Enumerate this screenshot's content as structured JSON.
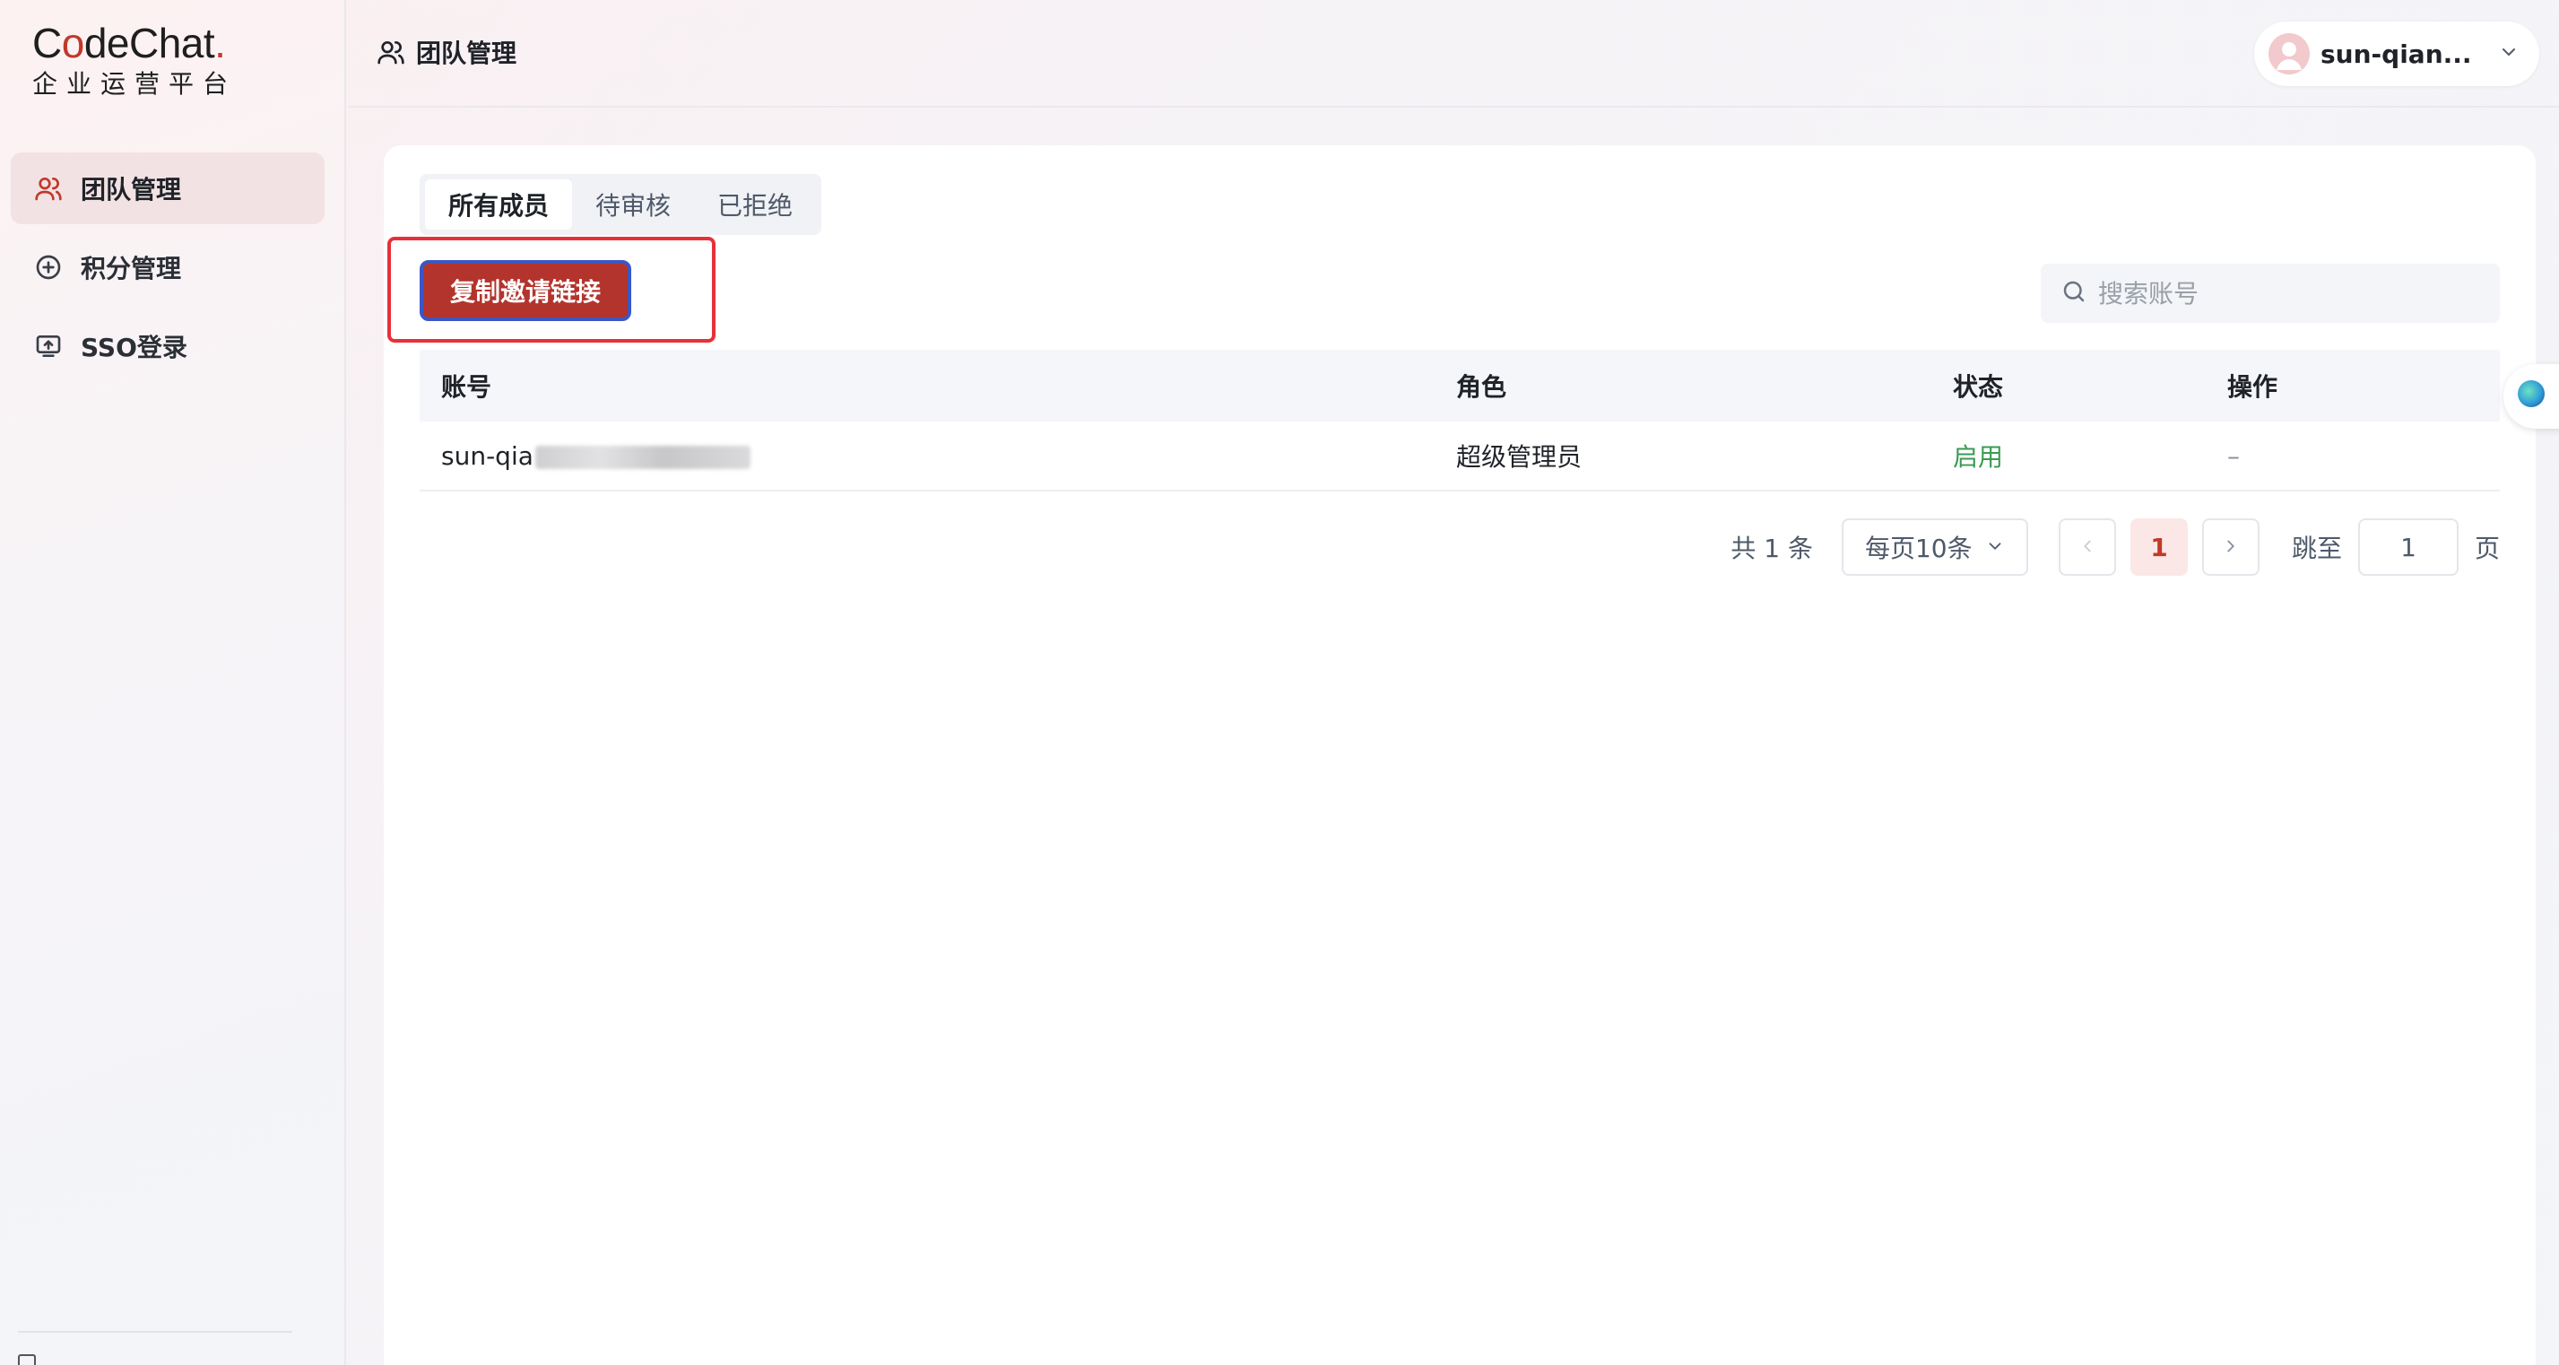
{
  "brand": {
    "logo_text_a": "C",
    "logo_text_o": "o",
    "logo_text_b": "deChat",
    "logo_dot": ".",
    "subtitle": "企业运营平台"
  },
  "sidebar": {
    "items": [
      {
        "label": "团队管理",
        "icon": "team-icon",
        "active": true
      },
      {
        "label": "积分管理",
        "icon": "plus-circle-icon",
        "active": false
      },
      {
        "label": "SSO登录",
        "icon": "upload-screen-icon",
        "active": false
      }
    ]
  },
  "header": {
    "title": "团队管理",
    "user_name": "sun-qian..."
  },
  "tabs": [
    {
      "label": "所有成员",
      "active": true
    },
    {
      "label": "待审核",
      "active": false
    },
    {
      "label": "已拒绝",
      "active": false
    }
  ],
  "toolbar": {
    "invite_label": "复制邀请链接",
    "search_placeholder": "搜索账号"
  },
  "table": {
    "headers": {
      "account": "账号",
      "role": "角色",
      "status": "状态",
      "action": "操作"
    },
    "rows": [
      {
        "account_prefix": "sun-qia",
        "role": "超级管理员",
        "status": "启用",
        "action": "–"
      }
    ]
  },
  "pagination": {
    "total_label": "共 1 条",
    "page_size_label": "每页10条",
    "current_page": "1",
    "jump_label": "跳至",
    "jump_value": "1",
    "jump_suffix": "页"
  },
  "colors": {
    "brand_red": "#b3342d",
    "highlight_border": "#e8303a",
    "status_green": "#3a9b54"
  }
}
